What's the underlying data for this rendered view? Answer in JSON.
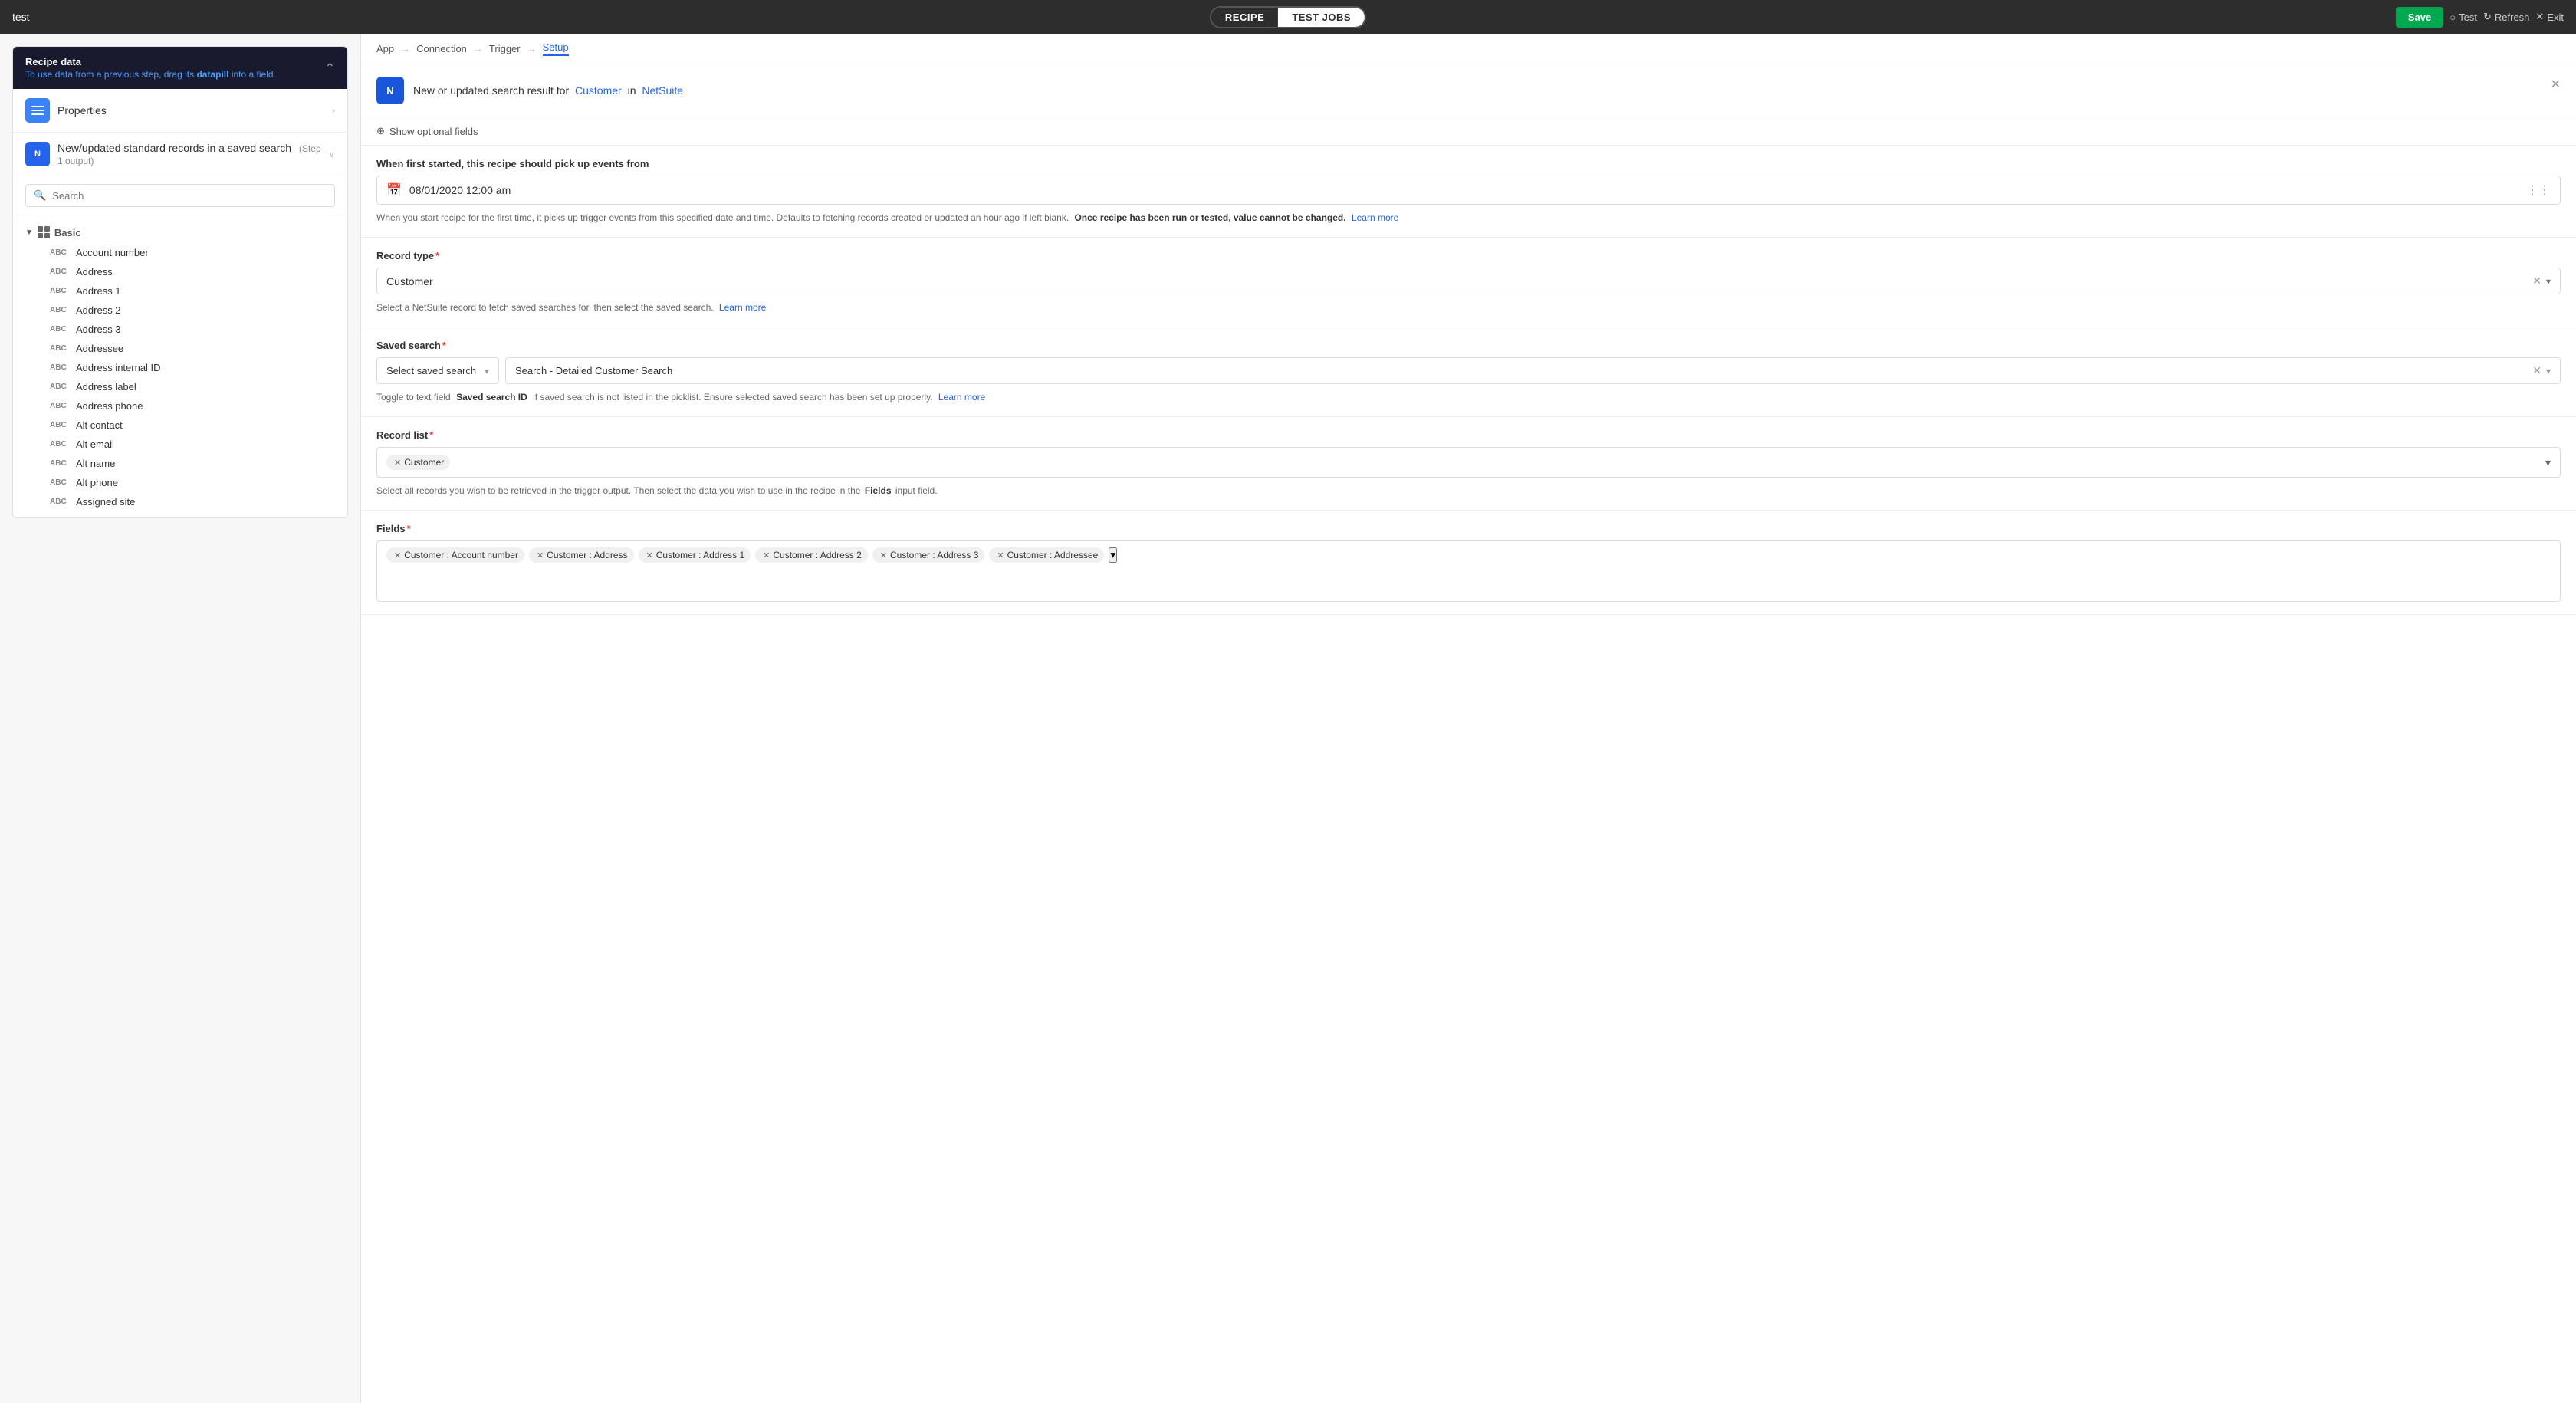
{
  "topbar": {
    "app_name": "test",
    "tab_recipe": "RECIPE",
    "tab_testjobs": "TEST JOBS",
    "save_label": "Save",
    "test_label": "Test",
    "refresh_label": "Refresh",
    "exit_label": "Exit"
  },
  "left_panel": {
    "recipe_data": {
      "title": "Recipe data",
      "subtitle": "To use data from a previous step, drag its",
      "datapill": "datapill",
      "subtitle2": "into a field"
    },
    "properties": {
      "label": "Properties"
    },
    "step1": {
      "label": "New/updated standard records in a saved search",
      "sublabel": "(Step 1 output)"
    },
    "search": {
      "placeholder": "Search"
    },
    "tree": {
      "group": "Basic",
      "items": [
        "Account number",
        "Address",
        "Address 1",
        "Address 2",
        "Address 3",
        "Addressee",
        "Address internal ID",
        "Address label",
        "Address phone",
        "Alt contact",
        "Alt email",
        "Alt name",
        "Alt phone",
        "Assigned site"
      ]
    }
  },
  "right_panel": {
    "nav": {
      "app": "App",
      "connection": "Connection",
      "trigger": "Trigger",
      "setup": "Setup"
    },
    "trigger": {
      "title": "New or updated search result for",
      "customer": "Customer",
      "in": "in",
      "netsuite": "NetSuite"
    },
    "optional_toggle": "Show optional fields",
    "datetime_section": {
      "label": "When first started, this recipe should pick up events from",
      "value": "08/01/2020 12:00 am",
      "helper": "When you start recipe for the first time, it picks up trigger events from this specified date and time. Defaults to fetching records created or updated an hour ago if left blank.",
      "bold_part": "Once recipe has been run or tested, value cannot be changed.",
      "learn_more": "Learn more"
    },
    "record_type": {
      "label": "Record type",
      "required": true,
      "value": "Customer",
      "helper": "Select a NetSuite record to fetch saved searches for, then select the saved search.",
      "learn_more": "Learn more"
    },
    "saved_search": {
      "label": "Saved search",
      "required": true,
      "left_value": "Select saved search",
      "right_value": "Search - Detailed Customer Search",
      "helper_start": "Toggle to text field",
      "bold_part": "Saved search ID",
      "helper_end": "if saved search is not listed in the picklist. Ensure selected saved search has been set up properly.",
      "learn_more": "Learn more"
    },
    "record_list": {
      "label": "Record list",
      "required": true,
      "tags": [
        "Customer"
      ]
    },
    "record_list_helper": "Select all records you wish to be retrieved in the trigger output. Then select the data you wish to use in the recipe in the",
    "record_list_bold": "Fields",
    "record_list_helper2": "input field.",
    "fields": {
      "label": "Fields",
      "required": true,
      "tags": [
        "Customer : Account number",
        "Customer : Address",
        "Customer : Address 1",
        "Customer : Address 2",
        "Customer : Address 3",
        "Customer : Addressee"
      ]
    }
  }
}
